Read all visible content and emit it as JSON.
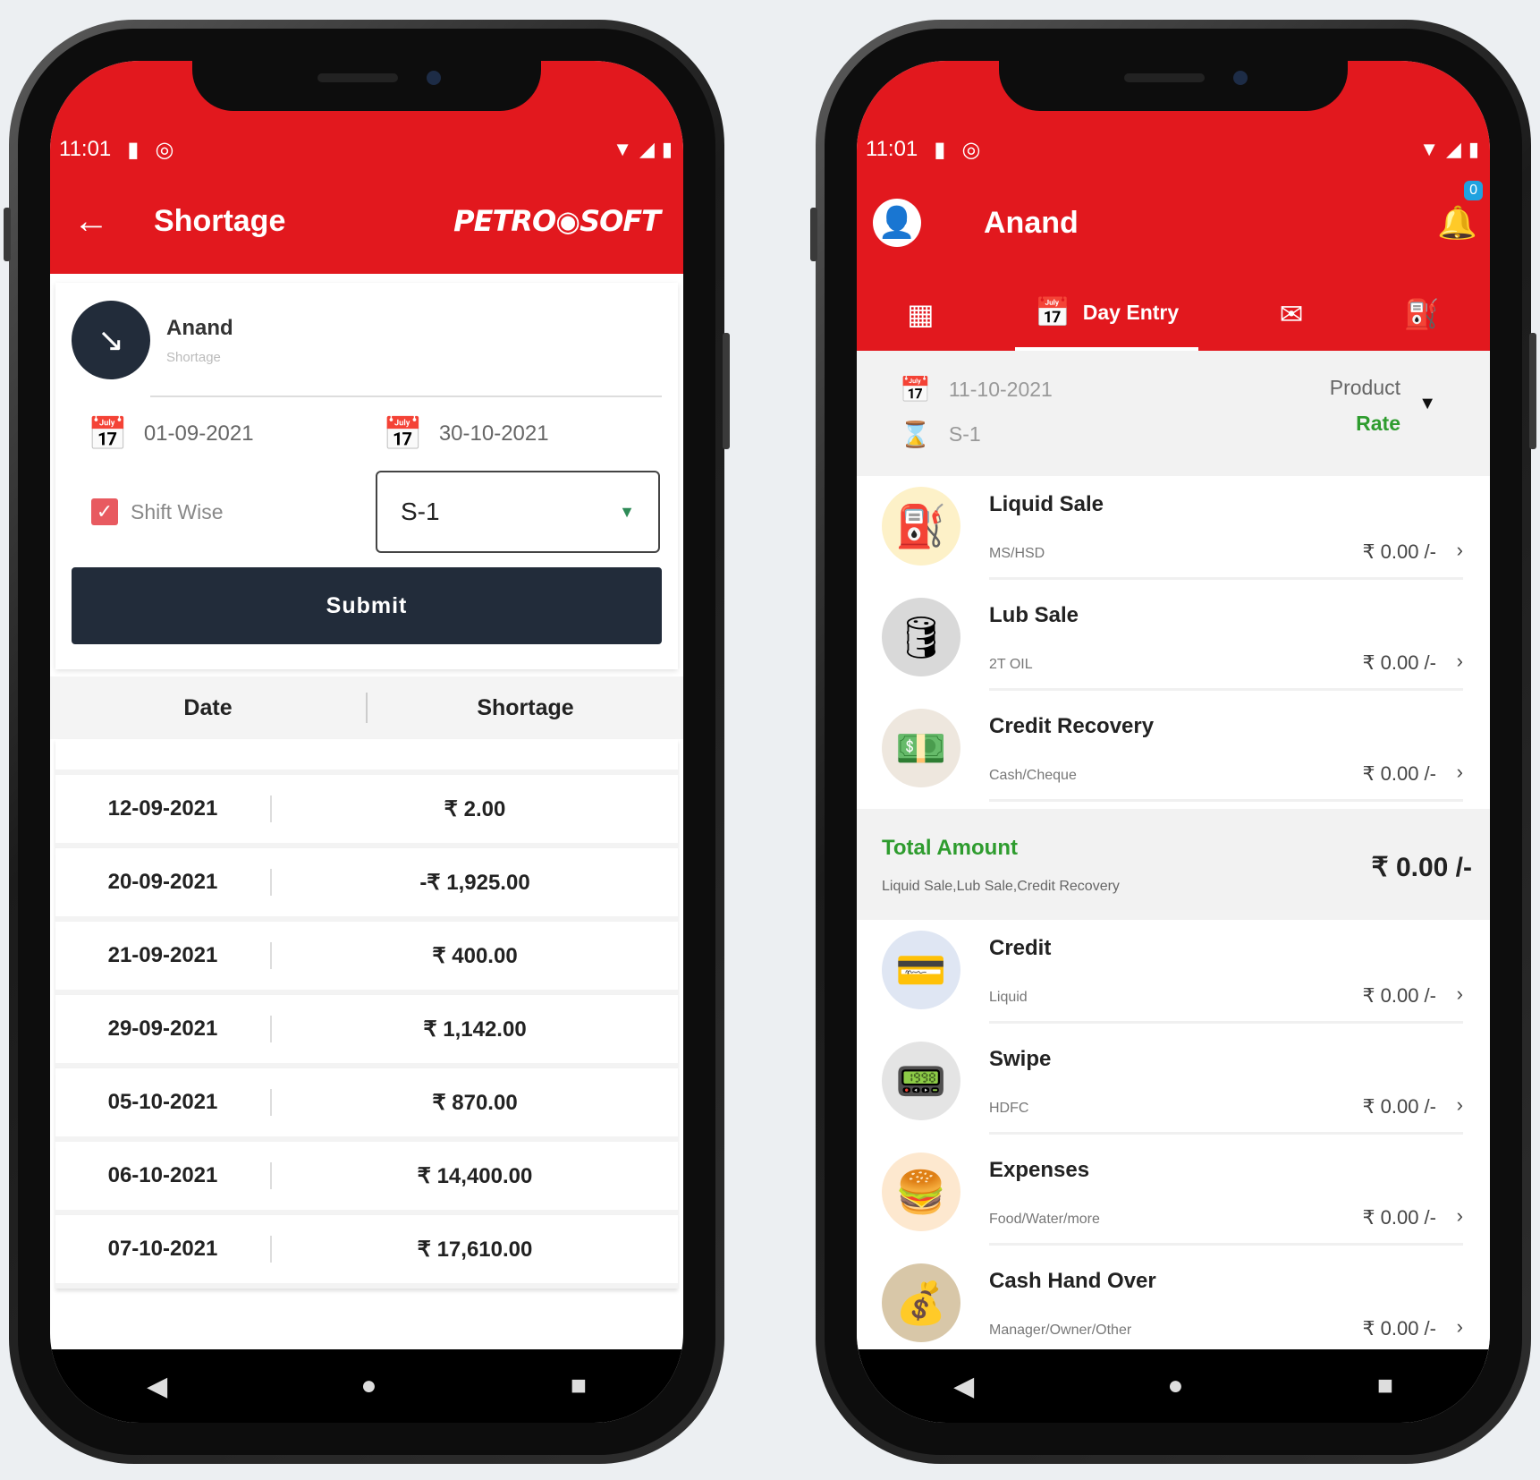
{
  "left": {
    "status": {
      "time": "11:01"
    },
    "appbar": {
      "title": "Shortage",
      "logo": "PETRO◉SOFT"
    },
    "user": {
      "name": "Anand",
      "subtitle": "Shortage"
    },
    "filters": {
      "from_date": "01-09-2021",
      "to_date": "30-10-2021",
      "shift_wise_label": "Shift Wise",
      "shift_value": "S-1"
    },
    "submit_label": "Submit",
    "table": {
      "headers": [
        "Date",
        "Shortage"
      ],
      "rows": [
        {
          "date": "12-09-2021",
          "value": "₹ 2.00"
        },
        {
          "date": "20-09-2021",
          "value": "-₹ 1,925.00"
        },
        {
          "date": "21-09-2021",
          "value": "₹ 400.00"
        },
        {
          "date": "29-09-2021",
          "value": "₹ 1,142.00"
        },
        {
          "date": "05-10-2021",
          "value": "₹ 870.00"
        },
        {
          "date": "06-10-2021",
          "value": "₹ 14,400.00"
        },
        {
          "date": "07-10-2021",
          "value": "₹ 17,610.00"
        }
      ]
    }
  },
  "right": {
    "status": {
      "time": "11:01"
    },
    "appbar": {
      "name": "Anand",
      "notification_count": "0"
    },
    "tabs": {
      "active_label": "Day Entry"
    },
    "filter": {
      "date": "11-10-2021",
      "shift": "S-1",
      "product_label": "Product",
      "rate_label": "Rate"
    },
    "items_top": [
      {
        "title": "Liquid Sale",
        "sub": "MS/HSD",
        "amount": "₹ 0.00 /-",
        "icon": "⛽"
      },
      {
        "title": "Lub Sale",
        "sub": "2T OIL",
        "amount": "₹ 0.00 /-",
        "icon": "🛢"
      },
      {
        "title": "Credit Recovery",
        "sub": "Cash/Cheque",
        "amount": "₹ 0.00 /-",
        "icon": "💵"
      }
    ],
    "total": {
      "title": "Total Amount",
      "sub": "Liquid Sale,Lub Sale,Credit Recovery",
      "value": "₹ 0.00 /-"
    },
    "items_bottom": [
      {
        "title": "Credit",
        "sub": "Liquid",
        "amount": "₹ 0.00 /-",
        "icon": "💳"
      },
      {
        "title": "Swipe",
        "sub": "HDFC",
        "amount": "₹ 0.00 /-",
        "icon": "📟"
      },
      {
        "title": "Expenses",
        "sub": "Food/Water/more",
        "amount": "₹ 0.00 /-",
        "icon": "🍔"
      },
      {
        "title": "Cash Hand Over",
        "sub": "Manager/Owner/Other",
        "amount": "₹ 0.00 /-",
        "icon": "💰"
      }
    ]
  },
  "colors": {
    "brand_red": "#e2181e",
    "dark_navy": "#222c3a",
    "accent_green": "#2e9c2e"
  }
}
